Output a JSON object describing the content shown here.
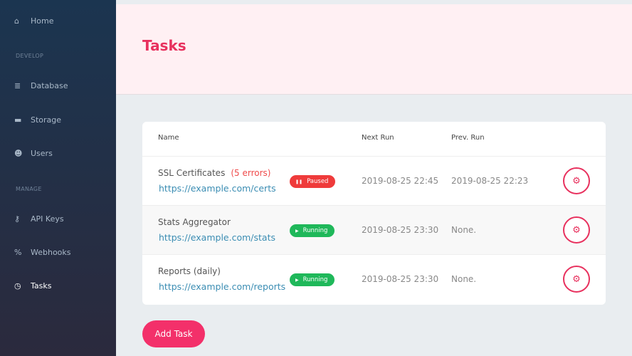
{
  "sidebar": {
    "items": [
      {
        "label": "Home",
        "icon": "home-icon",
        "glyph": "⌂"
      },
      {
        "label": "Database",
        "icon": "database-icon",
        "glyph": "≣"
      },
      {
        "label": "Storage",
        "icon": "folder-icon",
        "glyph": "▬"
      },
      {
        "label": "Users",
        "icon": "users-icon",
        "glyph": "☻"
      },
      {
        "label": "API Keys",
        "icon": "key-icon",
        "glyph": "⚷"
      },
      {
        "label": "Webhooks",
        "icon": "webhook-icon",
        "glyph": "%"
      },
      {
        "label": "Tasks",
        "icon": "clock-icon",
        "glyph": "◷"
      }
    ],
    "sections": [
      "DEVELOP",
      "MANAGE"
    ]
  },
  "header": {
    "title": "Tasks"
  },
  "table": {
    "columns": [
      "Name",
      "Next Run",
      "Prev. Run"
    ],
    "rows": [
      {
        "name": "SSL Certificates",
        "errors": "(5 errors)",
        "url": "https://example.com/certs",
        "status": "Paused",
        "status_glyph": "❚❚",
        "next": "2019-08-25 22:45",
        "prev": "2019-08-25 22:23"
      },
      {
        "name": "Stats Aggregator",
        "errors": "",
        "url": "https://example.com/stats",
        "status": "Running",
        "status_glyph": "▶",
        "next": "2019-08-25 23:30",
        "prev": "None."
      },
      {
        "name": "Reports (daily)",
        "errors": "",
        "url": "https://example.com/reports",
        "status": "Running",
        "status_glyph": "▶",
        "next": "2019-08-25 23:30",
        "prev": "None."
      }
    ]
  },
  "colors": {
    "paused": "#ef3b3b",
    "running": "#1fb85a",
    "accent": "#f3306a"
  },
  "add_task_label": "Add Task"
}
